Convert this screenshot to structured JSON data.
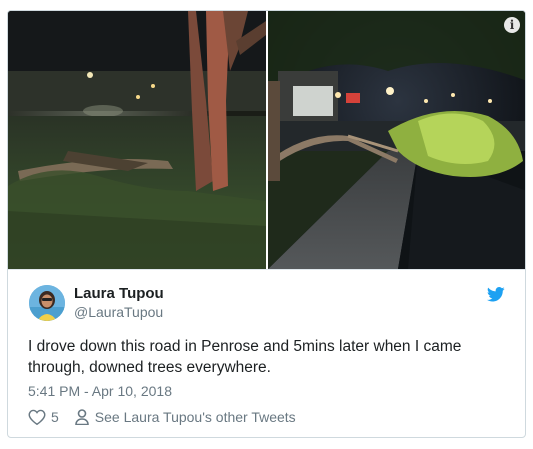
{
  "tweet": {
    "media": {
      "left_photo_alt": "fallen tree at night",
      "right_photo_alt": "downed tree over footpath at night",
      "info_icon": "info-icon"
    },
    "author": {
      "display_name": "Laura Tupou",
      "handle": "@LauraTupou",
      "avatar_icon": "avatar-icon"
    },
    "brand_icon": "twitter-bird-icon",
    "text": "I drove down this road in Penrose and 5mins later when I came through, downed trees everywhere.",
    "timestamp": "5:41 PM - Apr 10, 2018",
    "actions": {
      "like_icon": "heart-icon",
      "like_count": "5",
      "profile_icon": "person-icon",
      "profile_link": "See Laura Tupou's other Tweets"
    }
  },
  "colors": {
    "text": "#1c2022",
    "secondary_text": "#697882",
    "twitter_blue": "#1da1f2",
    "border": "#cfd9de"
  }
}
